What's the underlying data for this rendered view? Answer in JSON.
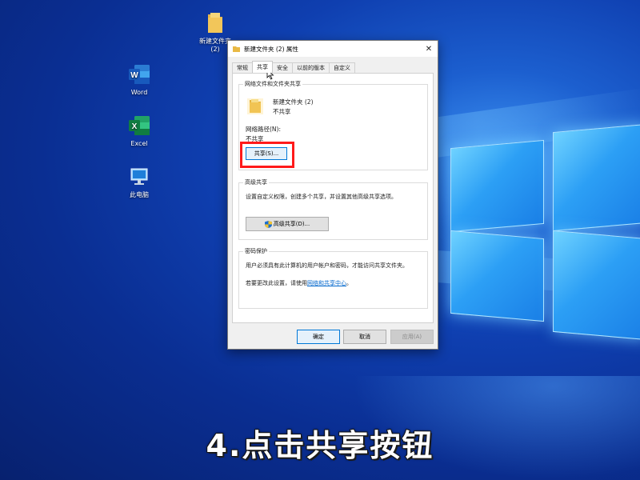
{
  "desktop": {
    "icons": [
      {
        "label": "新建文件夹\n(2)",
        "icon": "folder-icon"
      },
      {
        "label": "Word",
        "icon": "word-icon"
      },
      {
        "label": "Excel",
        "icon": "excel-icon"
      },
      {
        "label": "此电脑",
        "icon": "this-pc-icon"
      }
    ],
    "caption": "4.点击共享按钮"
  },
  "dialog": {
    "title": "新建文件夹 (2) 属性",
    "close_glyph": "✕",
    "tabs": [
      "常规",
      "共享",
      "安全",
      "以前的版本",
      "自定义"
    ],
    "active_tab": "共享",
    "network_section": {
      "title": "网络文件和文件夹共享",
      "folder_name": "新建文件夹 (2)",
      "share_status": "不共享",
      "path_label": "网络路径(N):",
      "path_value": "不共享",
      "share_button": "共享(S)..."
    },
    "advanced_section": {
      "title": "高级共享",
      "description": "设置自定义权限，创建多个共享，并设置其他高级共享选项。",
      "button": "高级共享(D)..."
    },
    "password_section": {
      "title": "密码保护",
      "description": "用户必须具有此计算机的用户帐户和密码，才能访问共享文件夹。",
      "change_prefix": "若要更改此设置，请使用",
      "link": "网络和共享中心",
      "change_suffix": "。"
    },
    "footer": {
      "ok": "确定",
      "cancel": "取消",
      "apply": "应用(A)"
    }
  },
  "colors": {
    "highlight": "#ff1a1a",
    "link": "#0066cc",
    "desktop_blue": "#0f3fb0"
  }
}
